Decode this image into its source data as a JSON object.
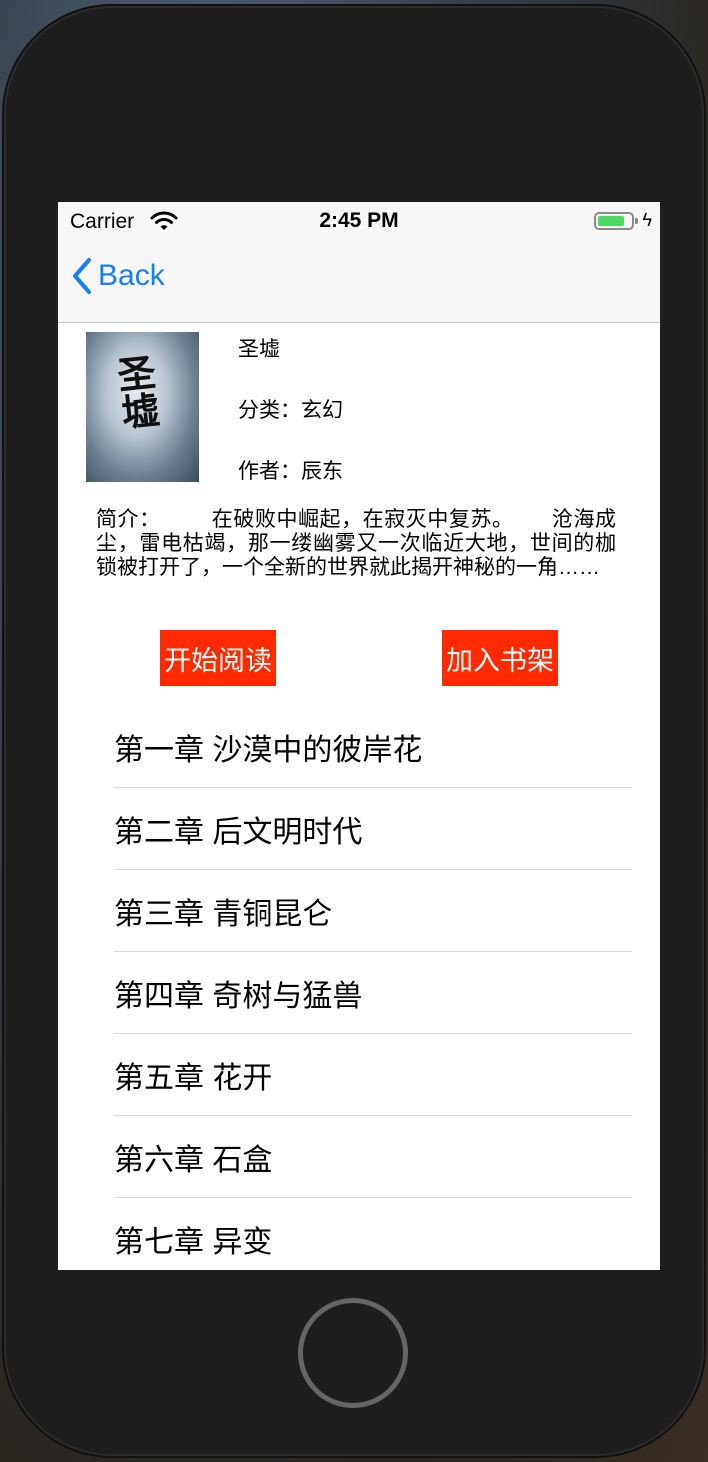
{
  "status": {
    "carrier": "Carrier",
    "time": "2:45 PM"
  },
  "nav": {
    "back_label": "Back"
  },
  "book": {
    "title": "圣墟",
    "category": "分类：玄幻",
    "author": "作者：辰东",
    "cover_text": "圣墟",
    "synopsis": "简介：        在破败中崛起，在寂灭中复苏。      沧海成尘，雷电枯竭，那一缕幽雾又一次临近大地，世间的枷锁被打开了，一个全新的世界就此揭开神秘的一角……"
  },
  "actions": {
    "read_label": "开始阅读",
    "shelf_label": "加入书架"
  },
  "chapters": [
    "第一章 沙漠中的彼岸花",
    "第二章 后文明时代",
    "第三章 青铜昆仑",
    "第四章 奇树与猛兽",
    "第五章 花开",
    "第六章 石盒",
    "第七章 异变"
  ],
  "colors": {
    "accent": "#157efb",
    "button": "#ff2a00",
    "battery": "#4cd964"
  }
}
